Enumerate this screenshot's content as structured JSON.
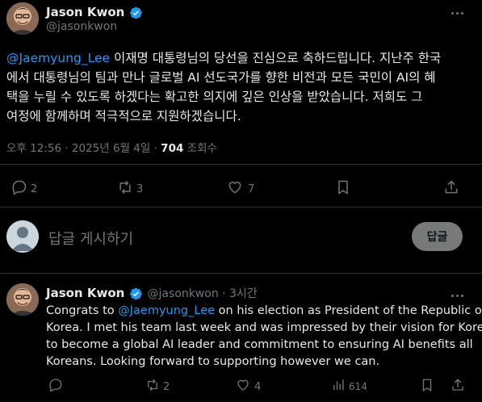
{
  "main_post": {
    "author_name": "Jason Kwon",
    "author_handle": "@jasonkwon",
    "mention": "@Jaemyung_Lee",
    "text_line1_rest": " 이재명 대통령님의 당선을 진심으로 축하드립니다. 지난주 한국",
    "text_line2": "에서 대통령님의 팀과 만나 글로벌 AI 선도국가를 향한 비전과 모든 국민이 AI의 혜",
    "text_line3": "택을 누릴 수 있도록 하겠다는 확고한 의지에 깊은 인상을 받았습니다. 저희도 그",
    "text_line4": "여정에 함께하며 적극적으로 지원하겠습니다.",
    "timestamp": "오후 12:56 · 2025년 6월 4일 · ",
    "views_count": "704",
    "views_label": " 조회수",
    "actions": {
      "reply_count": "2",
      "repost_count": "3",
      "like_count": "7"
    }
  },
  "reply_composer": {
    "placeholder": "답글 게시하기",
    "button_label": "답글"
  },
  "reply_post": {
    "author_name": "Jason Kwon",
    "author_handle": "@jasonkwon · 3시간",
    "line1_pre": "Congrats to ",
    "mention": "@Jaemyung_Lee",
    "line1_post": " on his election as President of the Republic of",
    "line2": "Korea. I met his team last week and was impressed by their vision for Korea",
    "line3": "to become a global AI leader and commitment to ensuring AI benefits all",
    "line4": "Koreans. Looking forward to supporting however we can.",
    "actions": {
      "reply_count": "",
      "repost_count": "2",
      "like_count": "4",
      "views_count": "614"
    }
  },
  "more_icon": "more-icon",
  "colors": {
    "accent": "#1d9bf0",
    "muted": "#71767b",
    "divider": "#2f3336"
  }
}
